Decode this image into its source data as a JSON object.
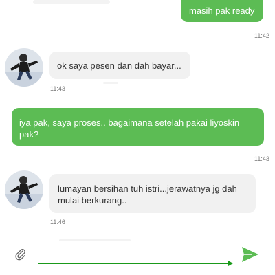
{
  "messages": [
    {
      "direction": "out",
      "text": "masih pak ready",
      "time": "11:42"
    },
    {
      "direction": "in",
      "text": "ok saya pesen dan dah bayar...",
      "time": "11:43"
    },
    {
      "direction": "out",
      "text": "iya pak, saya proses.. bagaimana setelah pakai liyoskin pak?",
      "time": "11:43"
    },
    {
      "direction": "in",
      "text": "lumayan bersihan tuh istri...jerawatnya jg dah mulai berkurang..",
      "time": "11:46"
    }
  ],
  "composer": {
    "placeholder": "",
    "value": ""
  },
  "icons": {
    "attach": "paperclip-icon",
    "send": "send-icon",
    "avatar": "user-avatar"
  },
  "colors": {
    "outgoing_bubble": "#5cbc54",
    "incoming_bubble": "#f1f1f1",
    "send": "#5cbc54",
    "underline": "#1a9a1a"
  }
}
